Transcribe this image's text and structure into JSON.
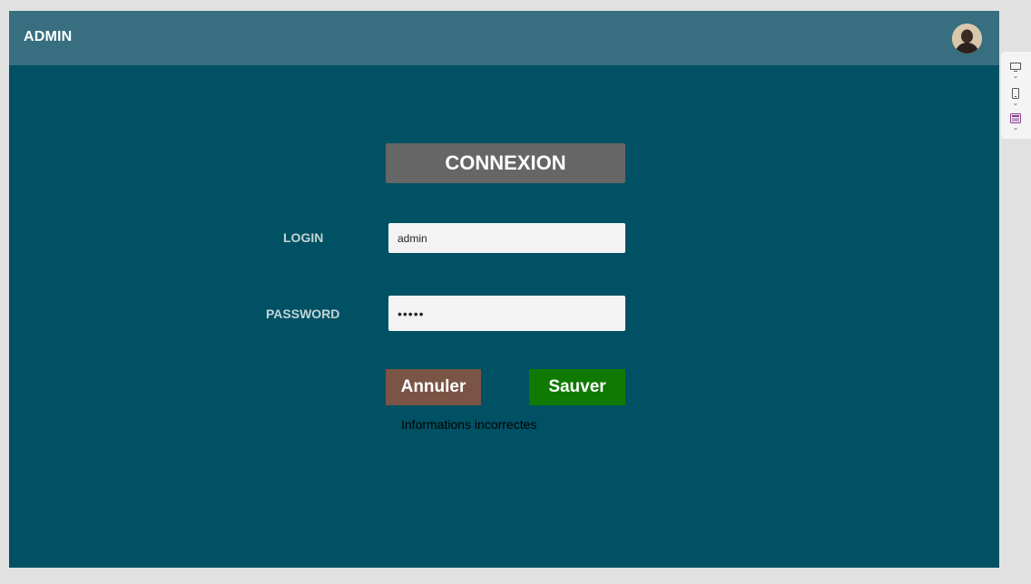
{
  "header": {
    "title": "ADMIN",
    "avatar_icon": "user-avatar"
  },
  "form": {
    "heading": "CONNEXION",
    "login_label": "LOGIN",
    "login_value": "admin",
    "password_label": "PASSWORD",
    "password_value": "•••••",
    "cancel_label": "Annuler",
    "save_label": "Sauver",
    "error_message": "Informations incorrectes"
  },
  "side_panel": {
    "tools": [
      {
        "icon": "desktop-view-icon"
      },
      {
        "icon": "mobile-view-icon"
      },
      {
        "icon": "tablet-view-icon"
      }
    ]
  },
  "colors": {
    "background": "#005163",
    "topbar": "#376f80",
    "heading_bg": "#666666",
    "cancel_bg": "#7a5546",
    "save_bg": "#0f7a03"
  }
}
